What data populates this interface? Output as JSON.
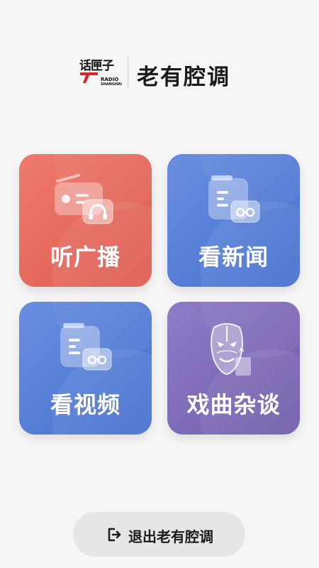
{
  "header": {
    "logo_main": "话匣子",
    "logo_sub1": "RADIO",
    "logo_sub2": "SHANGHAI",
    "title": "老有腔调"
  },
  "tiles": [
    {
      "label": "听广播",
      "icon": "radio-headphones-icon",
      "color": "#e4665b"
    },
    {
      "label": "看新闻",
      "icon": "news-glasses-icon",
      "color": "#5a80d8"
    },
    {
      "label": "看视频",
      "icon": "video-glasses-icon",
      "color": "#5a80d8"
    },
    {
      "label": "戏曲杂谈",
      "icon": "opera-mask-icon",
      "color": "#7f6bb8"
    }
  ],
  "exit": {
    "label": "退出老有腔调",
    "icon": "exit-icon"
  },
  "colors": {
    "background": "#f6f6f7",
    "logo_red": "#d7262a"
  }
}
